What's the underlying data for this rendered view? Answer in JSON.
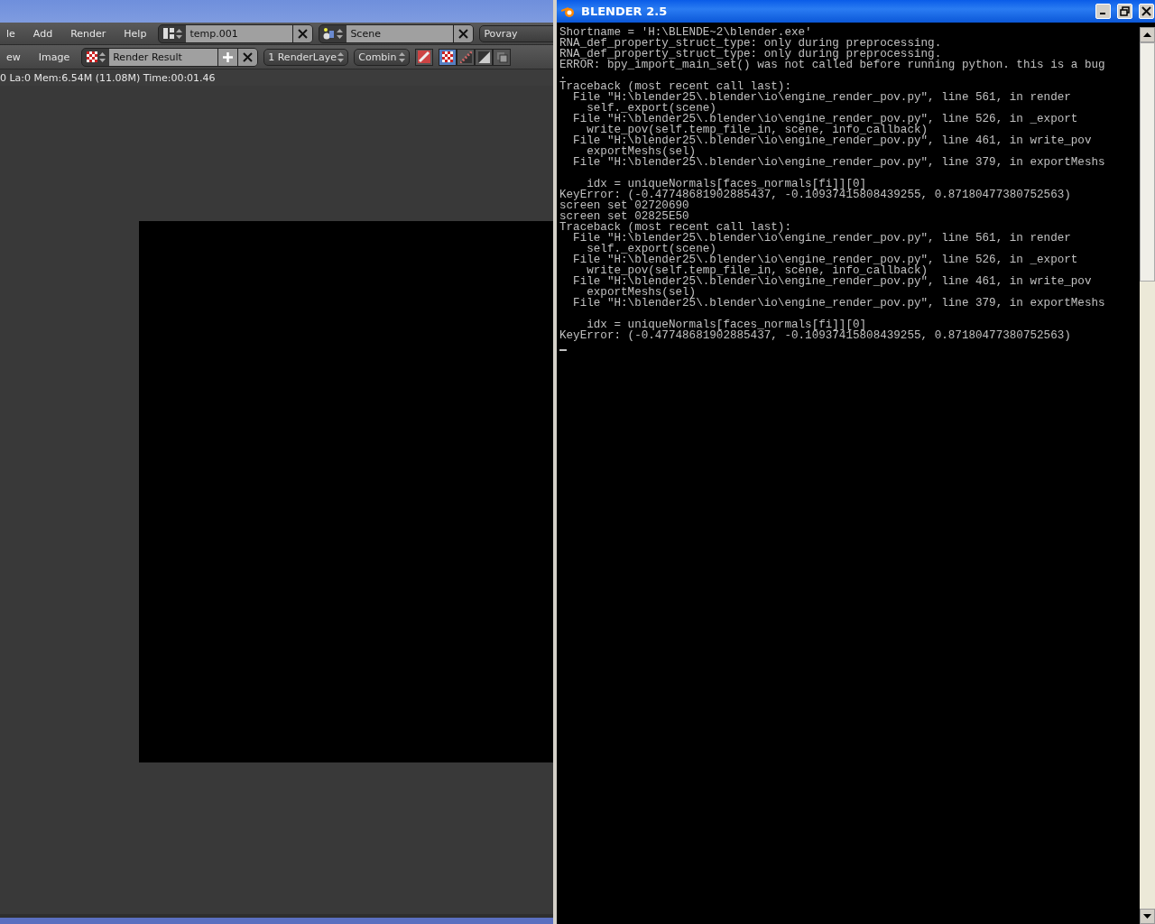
{
  "blender": {
    "menu": [
      "le",
      "Add",
      "Render",
      "Help"
    ],
    "screen_field": {
      "value": "temp.001"
    },
    "scene_field": {
      "value": "Scene"
    },
    "engine_dropdown": {
      "value": "Povray"
    },
    "image_menu": [
      "ew",
      "Image"
    ],
    "image_field": {
      "value": "Render Result"
    },
    "layer_dropdown": {
      "value": "1 RenderLaye"
    },
    "pass_dropdown": {
      "value": "Combin"
    },
    "draw_modes": [
      {
        "kind": "checker",
        "selected": true
      },
      {
        "kind": "alpha",
        "selected": false
      },
      {
        "kind": "zbuf",
        "selected": false
      },
      {
        "kind": "overlay",
        "selected": false
      }
    ],
    "status": "0 La:0 Mem:6.54M (11.08M) Time:00:01.46"
  },
  "console": {
    "window": {
      "title": "BLENDER 2.5"
    },
    "lines": [
      {
        "kind": "text",
        "text": "Shortname = 'H:\\BLENDE~2\\blender.exe'"
      },
      {
        "kind": "text",
        "text": "RNA_def_property_struct_type: only during preprocessing."
      },
      {
        "kind": "text",
        "text": "RNA_def_property_struct_type: only during preprocessing."
      },
      {
        "kind": "text",
        "text": "ERROR: bpy_import_main_set() was not called before running python. this is a bug"
      },
      {
        "kind": "text",
        "text": "."
      },
      {
        "kind": "text",
        "text": "Traceback (most recent call last):"
      },
      {
        "kind": "text",
        "text": "  File \"H:\\blender25\\.blender\\io\\engine_render_pov.py\", line 561, in render"
      },
      {
        "kind": "text",
        "text": "    self._export(scene)"
      },
      {
        "kind": "text",
        "text": "  File \"H:\\blender25\\.blender\\io\\engine_render_pov.py\", line 526, in _export"
      },
      {
        "kind": "text",
        "text": "    write_pov(self.temp_file_in, scene, info_callback)"
      },
      {
        "kind": "text",
        "text": "  File \"H:\\blender25\\.blender\\io\\engine_render_pov.py\", line 461, in write_pov"
      },
      {
        "kind": "text",
        "text": "    exportMeshs(sel)"
      },
      {
        "kind": "text",
        "text": "  File \"H:\\blender25\\.blender\\io\\engine_render_pov.py\", line 379, in exportMeshs"
      },
      {
        "kind": "blank"
      },
      {
        "kind": "text",
        "text": "    idx = uniqueNormals[faces_normals[fi]][0]"
      },
      {
        "kind": "text",
        "text": "KeyError: (-0.47748681902885437, -0.10937415808439255, 0.87180477380752563)"
      },
      {
        "kind": "text",
        "text": "screen set 02720690"
      },
      {
        "kind": "text",
        "text": "screen set 02825E50"
      },
      {
        "kind": "text",
        "text": "Traceback (most recent call last):"
      },
      {
        "kind": "text",
        "text": "  File \"H:\\blender25\\.blender\\io\\engine_render_pov.py\", line 561, in render"
      },
      {
        "kind": "text",
        "text": "    self._export(scene)"
      },
      {
        "kind": "text",
        "text": "  File \"H:\\blender25\\.blender\\io\\engine_render_pov.py\", line 526, in _export"
      },
      {
        "kind": "text",
        "text": "    write_pov(self.temp_file_in, scene, info_callback)"
      },
      {
        "kind": "text",
        "text": "  File \"H:\\blender25\\.blender\\io\\engine_render_pov.py\", line 461, in write_pov"
      },
      {
        "kind": "text",
        "text": "    exportMeshs(sel)"
      },
      {
        "kind": "text",
        "text": "  File \"H:\\blender25\\.blender\\io\\engine_render_pov.py\", line 379, in exportMeshs"
      },
      {
        "kind": "blank"
      },
      {
        "kind": "text",
        "text": "    idx = uniqueNormals[faces_normals[fi]][0]"
      },
      {
        "kind": "text",
        "text": "KeyError: (-0.47748681902885437, -0.10937415808439255, 0.87180477380752563)"
      }
    ]
  }
}
